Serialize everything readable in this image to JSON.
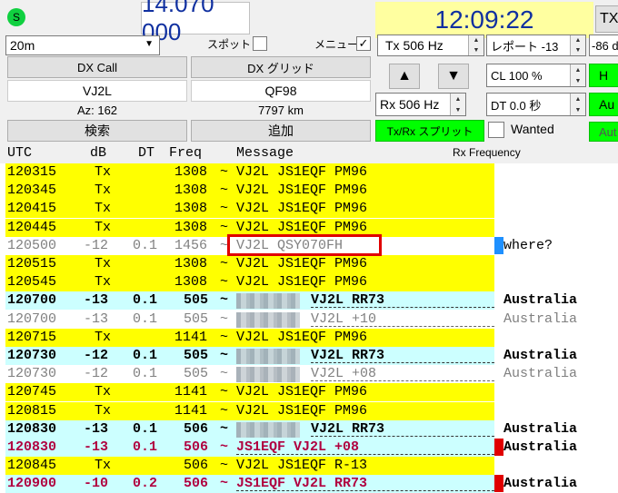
{
  "status_indicator": "S",
  "dial_frequency": "14.070 000",
  "clock": "12:09:22",
  "tx_button": "TX",
  "band": {
    "value": "20m"
  },
  "spot_label": "スポット",
  "menu_label": "メニュー",
  "dx_call": {
    "label": "DX Call",
    "value": "VJ2L",
    "az": "Az: 162"
  },
  "dx_grid": {
    "label": "DX グリッド",
    "value": "QF98",
    "distance": "7797 km"
  },
  "search_button": "検索",
  "add_button": "追加",
  "tx_freq": "Tx  506  Hz",
  "rx_freq": "Rx  506  Hz",
  "report": "レポート -13",
  "right_edge_value": "-86 d",
  "cl": "CL  100 %",
  "dt": "DT  0.0 秒",
  "split_button": "Tx/Rx スプリット",
  "wanted_label": "Wanted",
  "green_btn_1": "H",
  "green_btn_2": "Au",
  "green_btn_3": "Aut",
  "up_arrow": "▲",
  "down_arrow": "▼",
  "table_header": {
    "utc": "UTC",
    "db": "dB",
    "dt": "DT",
    "freq": "Freq",
    "message": "Message",
    "rx_frequency": "Rx Frequency"
  },
  "rows": [
    {
      "utc": "120315",
      "db": "Tx",
      "dt": "",
      "freq": "1308",
      "sep": "~",
      "msg": "VJ2L JS1EQF PM96",
      "loc": "",
      "style": "tx"
    },
    {
      "utc": "120345",
      "db": "Tx",
      "dt": "",
      "freq": "1308",
      "sep": "~",
      "msg": "VJ2L JS1EQF PM96",
      "loc": "",
      "style": "tx"
    },
    {
      "utc": "120415",
      "db": "Tx",
      "dt": "",
      "freq": "1308",
      "sep": "~",
      "msg": "VJ2L JS1EQF PM96",
      "loc": "",
      "style": "tx"
    },
    {
      "utc": "120445",
      "db": "Tx",
      "dt": "",
      "freq": "1308",
      "sep": "~",
      "msg": "VJ2L JS1EQF PM96",
      "loc": "",
      "style": "tx"
    },
    {
      "utc": "120500",
      "db": "-12",
      "dt": "0.1",
      "freq": "1456",
      "sep": "~",
      "msg": "VJ2L QSY070FH",
      "loc": "where?",
      "style": "gray"
    },
    {
      "utc": "120515",
      "db": "Tx",
      "dt": "",
      "freq": "1308",
      "sep": "~",
      "msg": "VJ2L JS1EQF PM96",
      "loc": "",
      "style": "tx"
    },
    {
      "utc": "120545",
      "db": "Tx",
      "dt": "",
      "freq": "1308",
      "sep": "~",
      "msg": "VJ2L JS1EQF PM96",
      "loc": "",
      "style": "tx"
    },
    {
      "utc": "120700",
      "db": "-13",
      "dt": "0.1",
      "freq": "505",
      "sep": "~",
      "msg": "VJ2L RR73",
      "loc": "Australia",
      "style": "bold"
    },
    {
      "utc": "120700",
      "db": "-13",
      "dt": "0.1",
      "freq": "505",
      "sep": "~",
      "msg": "VJ2L +10",
      "loc": "Australia",
      "style": "graydup"
    },
    {
      "utc": "120715",
      "db": "Tx",
      "dt": "",
      "freq": "1141",
      "sep": "~",
      "msg": "VJ2L JS1EQF PM96",
      "loc": "",
      "style": "tx"
    },
    {
      "utc": "120730",
      "db": "-12",
      "dt": "0.1",
      "freq": "505",
      "sep": "~",
      "msg": "VJ2L RR73",
      "loc": "Australia",
      "style": "bold"
    },
    {
      "utc": "120730",
      "db": "-12",
      "dt": "0.1",
      "freq": "505",
      "sep": "~",
      "msg": "VJ2L +08",
      "loc": "Australia",
      "style": "graydup"
    },
    {
      "utc": "120745",
      "db": "Tx",
      "dt": "",
      "freq": "1141",
      "sep": "~",
      "msg": "VJ2L JS1EQF PM96",
      "loc": "",
      "style": "tx"
    },
    {
      "utc": "120815",
      "db": "Tx",
      "dt": "",
      "freq": "1141",
      "sep": "~",
      "msg": "VJ2L JS1EQF PM96",
      "loc": "",
      "style": "tx"
    },
    {
      "utc": "120830",
      "db": "-13",
      "dt": "0.1",
      "freq": "506",
      "sep": "~",
      "msg": "VJ2L RR73",
      "loc": "Australia",
      "style": "bold"
    },
    {
      "utc": "120830",
      "db": "-13",
      "dt": "0.1",
      "freq": "506",
      "sep": "~",
      "msg": "JS1EQF VJ2L +08",
      "loc": "Australia",
      "style": "red"
    },
    {
      "utc": "120845",
      "db": "Tx",
      "dt": "",
      "freq": "506",
      "sep": "~",
      "msg": "VJ2L JS1EQF R-13",
      "loc": "",
      "style": "tx"
    },
    {
      "utc": "120900",
      "db": "-10",
      "dt": "0.2",
      "freq": "506",
      "sep": "~",
      "msg": "JS1EQF VJ2L RR73",
      "loc": "Australia",
      "style": "red"
    }
  ],
  "colors": {
    "tx_bg": "#ffff00",
    "rx_bg": "#ccffff",
    "red_text": "#b00040",
    "gray_text": "#808080",
    "highlight_box": "#e00000",
    "blue_marker": "#1e90ff",
    "red_marker": "#e00000",
    "green": "#00ff00",
    "dial_bg": "#ffffff",
    "clock_bg": "#ffffa0"
  }
}
